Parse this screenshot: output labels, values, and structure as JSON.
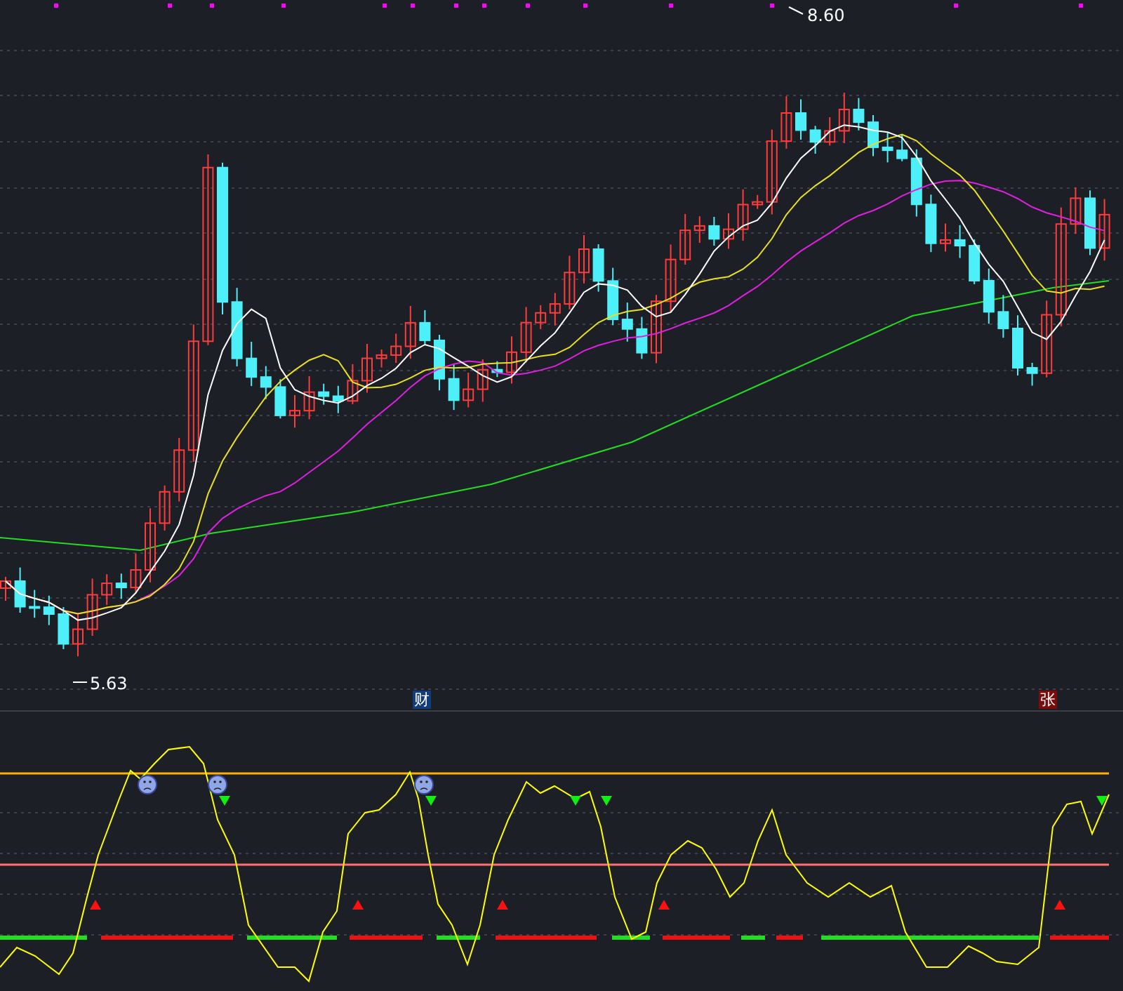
{
  "price_chart": {
    "high_label": "8.60",
    "low_label": "5.63"
  },
  "event_markers": [
    {
      "text": "财",
      "color": "#123d7a"
    },
    {
      "text": "张",
      "color": "#7a0c0c"
    }
  ]
}
